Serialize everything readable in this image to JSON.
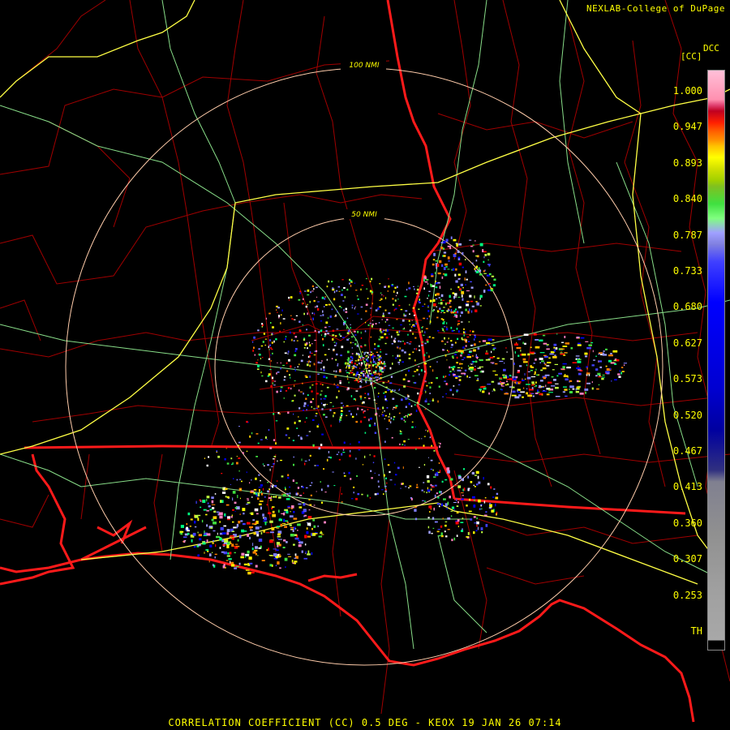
{
  "credit": "NEXLAB-College of DuPage",
  "footer": "CORRELATION COEFFICIENT (CC) 0.5 DEG - KEOX 19 JAN 26 07:14",
  "legend": {
    "product": "DCC",
    "unit": "[CC]",
    "ticks": [
      "1.000",
      "0.947",
      "0.893",
      "0.840",
      "0.787",
      "0.733",
      "0.680",
      "0.627",
      "0.573",
      "0.520",
      "0.467",
      "0.413",
      "0.360",
      "0.307",
      "0.253",
      "TH"
    ]
  },
  "range_rings": {
    "inner": "50 NMI",
    "outer": "100 NMI"
  },
  "colors": {
    "state_lines": "#ff1a1a",
    "county_lines": "#b00000",
    "highways_interstate": "#ffff44",
    "highways_other": "#88dd88",
    "range_rings": "#ffccaa"
  }
}
